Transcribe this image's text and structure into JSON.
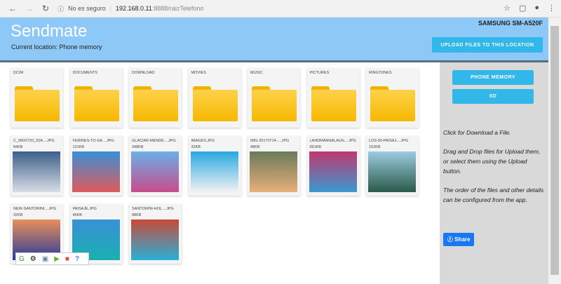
{
  "browser": {
    "security": "No es seguro",
    "url_host": "192.168.0.11",
    "url_rest": ":8888/raizTelefono"
  },
  "header": {
    "title": "Sendmate",
    "location": "Current location: Phone memory",
    "device": "SAMSUNG SM-A520F",
    "upload_label": "UPLOAD FILES TO THIS LOCATION"
  },
  "sidebar": {
    "phone_memory": "PHONE MEMORY",
    "sd": "SD",
    "help1": "Click for Download a File.",
    "help2": "Drag and Drop files for Upload them, or select them using the Upload button.",
    "help3": "The order of the files and other details can be configured from the app.",
    "share": "Share"
  },
  "folders": [
    {
      "name": "DCIM"
    },
    {
      "name": "DOCUMENTS"
    },
    {
      "name": "DOWNLOAD"
    },
    {
      "name": "MOVIES"
    },
    {
      "name": "MUSIC"
    },
    {
      "name": "PICTURES"
    },
    {
      "name": "RINGTONES"
    }
  ],
  "files": [
    {
      "name": "C_960X720_02A....JPG",
      "size": "84KB",
      "colors": [
        "#3b5f8a",
        "#d8dde5"
      ]
    },
    {
      "name": "FERRIES-TO-SA....JPG",
      "size": "131KB",
      "colors": [
        "#3a8fd6",
        "#e05a5a"
      ]
    },
    {
      "name": "GLACIAR-MENDE....JPG",
      "size": "348KB",
      "colors": [
        "#6ab0e8",
        "#c84c8c"
      ]
    },
    {
      "name": "IMAGES.JPG",
      "size": "32KB",
      "colors": [
        "#2aa8e0",
        "#f2f2f2"
      ]
    },
    {
      "name": "IMG-20170714-....JPG",
      "size": "98KB",
      "colors": [
        "#6a7a5a",
        "#e7b07a"
      ]
    },
    {
      "name": "LANDMANNALAUG....JPG",
      "size": "991KB",
      "colors": [
        "#c03870",
        "#3a9ad0"
      ]
    },
    {
      "name": "LOS-50-PAISAJ....JPG",
      "size": "152KB",
      "colors": [
        "#9ccce0",
        "#2a5a4a"
      ]
    },
    {
      "name": "NEW-SANTORINI....JPG",
      "size": "32KB",
      "colors": [
        "#e8905a",
        "#2a3a9a"
      ]
    },
    {
      "name": "PAISAJE.JPG",
      "size": "46KB",
      "colors": [
        "#3a90d8",
        "#1ab0b0"
      ]
    },
    {
      "name": "SANTORINI-HOL....JPG",
      "size": "98KB",
      "colors": [
        "#c84a3a",
        "#28b0d8"
      ]
    }
  ],
  "colors": {
    "header": "#8ec8f6",
    "button": "#31b7ea",
    "sidebar": "#d9d9d9"
  }
}
